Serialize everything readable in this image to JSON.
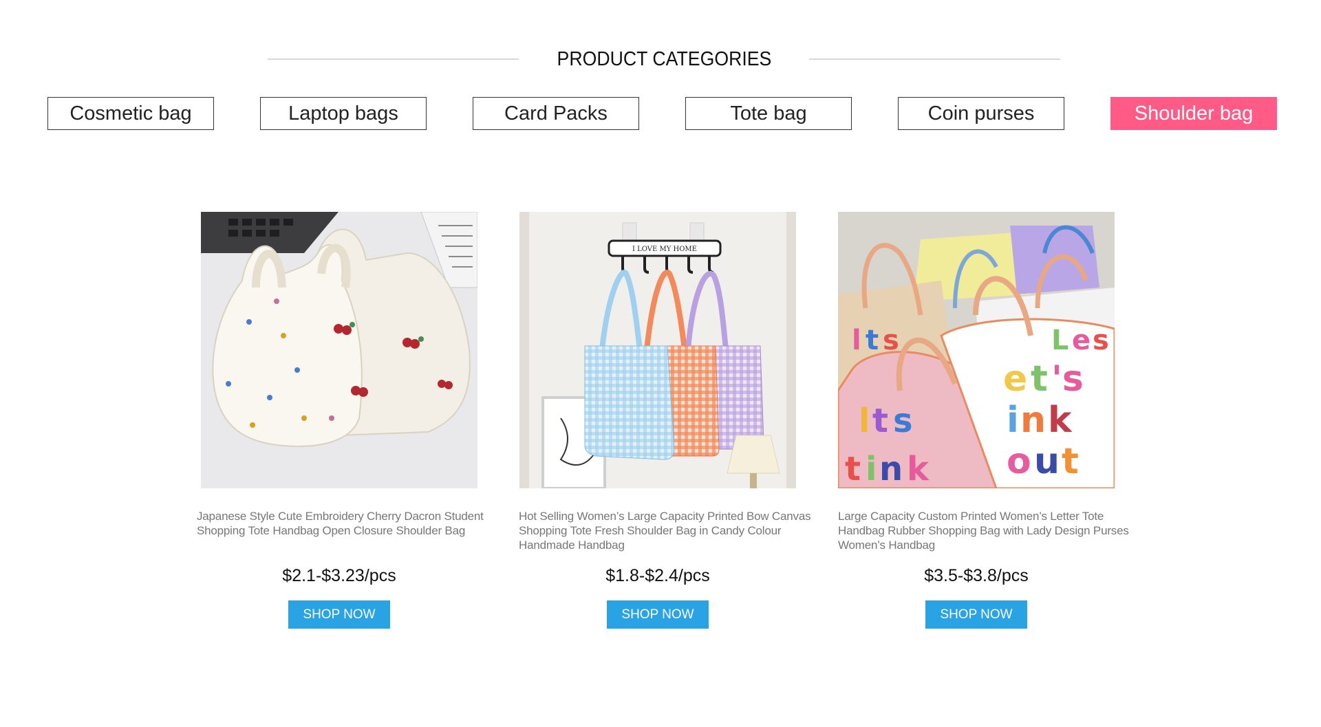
{
  "section": {
    "title": "PRODUCT CATEGORIES"
  },
  "tabs": [
    {
      "label": "Cosmetic bag",
      "active": false
    },
    {
      "label": "Laptop bags",
      "active": false
    },
    {
      "label": "Card Packs",
      "active": false
    },
    {
      "label": "Tote bag",
      "active": false
    },
    {
      "label": "Coin purses",
      "active": false
    },
    {
      "label": "Shoulder bag",
      "active": true
    }
  ],
  "products": [
    {
      "title": "Japanese Style Cute Embroidery Cherry Dacron Student Shopping Tote Handbag Open Closure Shoulder Bag",
      "price": "$2.1-$3.23/pcs",
      "button": "SHOP NOW",
      "image": "cream-embroidered-cherry-tote-bags"
    },
    {
      "title": "Hot Selling Women’s Large Capacity Printed Bow Canvas Shopping Tote Fresh Shoulder Bag in Candy Colour Handmade Handbag",
      "price": "$1.8-$2.4/pcs",
      "button": "SHOP NOW",
      "image": "gingham-tote-bags-on-hook",
      "hook_sign": "I LOVE MY HOME"
    },
    {
      "title": "Large Capacity Custom Printed Women’s Letter Tote Handbag Rubber Shopping Bag with Lady Design Purses Women’s Handbag",
      "price": "$3.5-$3.8/pcs",
      "button": "SHOP NOW",
      "image": "colorful-letter-tote-bags"
    }
  ],
  "colors": {
    "active_tab": "#ff5b86",
    "button": "#29a3e3",
    "heading_line": "#d8d8d8"
  }
}
